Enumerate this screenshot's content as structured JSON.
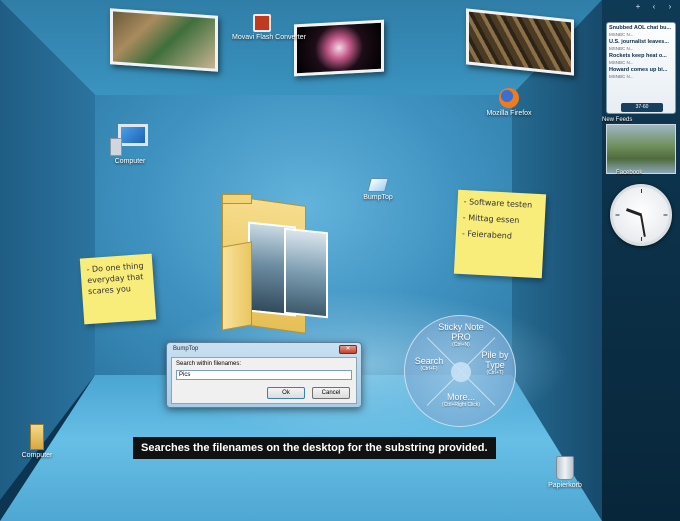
{
  "desktop": {
    "icons": {
      "movavi": "Movavi Flash Converter",
      "firefox": "Mozilla Firefox",
      "computer": "Computer",
      "bumptop": "BumpTop",
      "computer2": "Computer",
      "trash": "Papierkorb"
    }
  },
  "notes": {
    "left": "- Do one thing everyday that scares you",
    "right": [
      "- Software testen",
      "- Mittag essen",
      "- Feierabend"
    ]
  },
  "pie_menu": {
    "top": "Sticky Note",
    "top_sub": "PRO",
    "top_hint": "(Ctrl+N)",
    "left": "Search",
    "left_hint": "(Ctrl+F)",
    "right": "Pile by Type",
    "right_hint": "(Ctrl+T)",
    "bottom": "More...",
    "bottom_hint": "(Ctrl+Right Click)"
  },
  "dialog": {
    "title": "BumpTop",
    "label": "Search within filenames:",
    "input_value": "Pics",
    "ok_label": "Ok",
    "cancel_label": "Cancel"
  },
  "caption": "Searches the filenames on the desktop for the substring provided.",
  "sidebar": {
    "toolbar": {
      "add": "+",
      "prev": "‹",
      "next": "›"
    },
    "feeds": [
      {
        "headline": "Snubbed AOL chat bu...",
        "source": "MSNBC N..."
      },
      {
        "headline": "U.S. journalist leaves...",
        "source": "MSNBC N..."
      },
      {
        "headline": "Rockets keep heat o...",
        "source": "MSNBC N..."
      },
      {
        "headline": "Howard comes up bi...",
        "source": "MSNBC N..."
      }
    ],
    "feed_pager": "37-60",
    "news_label": "New Feeds",
    "fb_label": "Facebook"
  }
}
